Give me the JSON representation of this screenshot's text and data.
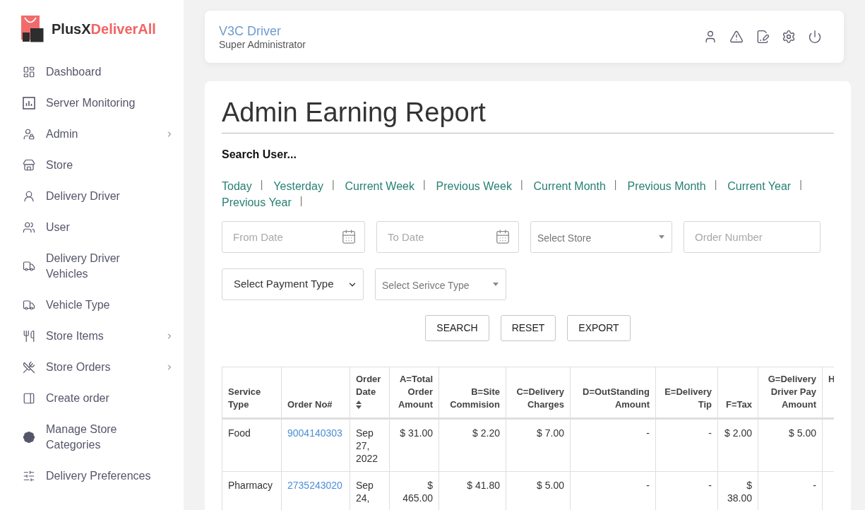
{
  "brand": {
    "name": "PlusX",
    "name_accent": "DeliverAll"
  },
  "sidebar": {
    "items": [
      {
        "label": "Dashboard",
        "has_submenu": false
      },
      {
        "label": "Server Monitoring",
        "has_submenu": false
      },
      {
        "label": "Admin",
        "has_submenu": true
      },
      {
        "label": "Store",
        "has_submenu": false
      },
      {
        "label": "Delivery Driver",
        "has_submenu": false
      },
      {
        "label": "User",
        "has_submenu": false
      },
      {
        "label": "Delivery Driver Vehicles",
        "has_submenu": false
      },
      {
        "label": "Vehicle Type",
        "has_submenu": false
      },
      {
        "label": "Store Items",
        "has_submenu": true
      },
      {
        "label": "Store Orders",
        "has_submenu": true
      },
      {
        "label": "Create order",
        "has_submenu": false
      },
      {
        "label": "Manage Store Categories",
        "has_submenu": false
      },
      {
        "label": "Delivery Preferences",
        "has_submenu": false
      }
    ]
  },
  "header": {
    "user_name": "V3C Driver",
    "role": "Super Administrator"
  },
  "report": {
    "title": "Admin Earning Report",
    "search_heading": "Search User...",
    "quick_ranges": [
      {
        "label": "Today",
        "separator": "|"
      },
      {
        "label": "Yesterday",
        "separator": "|"
      },
      {
        "label": "Current Week",
        "separator": "|"
      },
      {
        "label": "Previous Week",
        "separator": "|"
      },
      {
        "label": "Current Month",
        "separator": "|"
      },
      {
        "label": "Previous Month",
        "separator": "|"
      },
      {
        "label": "Current Year",
        "separator": "|"
      },
      {
        "label": "Previous Year",
        "separator": "|"
      }
    ],
    "filter_rows": [
      {
        "fields": [
          {
            "kind": "date",
            "placeholder": "From Date"
          },
          {
            "kind": "date",
            "placeholder": "To Date"
          },
          {
            "kind": "select",
            "placeholder": "Select Store"
          },
          {
            "kind": "text",
            "placeholder": "Order Number"
          }
        ]
      },
      {
        "fields": [
          {
            "kind": "dropdown",
            "value": "Select Payment Type"
          },
          {
            "kind": "select",
            "placeholder": "Select Serivce Type"
          }
        ]
      }
    ],
    "buttons": [
      "SEARCH",
      "RESET",
      "EXPORT"
    ],
    "table": {
      "columns": [
        {
          "label": "Service Type",
          "kind": "text",
          "sortable": false,
          "cut_off": false
        },
        {
          "label": "Order No#",
          "kind": "link",
          "sortable": false,
          "cut_off": false
        },
        {
          "label": "Order Date",
          "kind": "date",
          "sortable": true,
          "cut_off": false
        },
        {
          "label": "A=Total Order Amount",
          "kind": "amount",
          "sortable": false,
          "cut_off": false
        },
        {
          "label": "B=Site Commision",
          "kind": "amount",
          "sortable": false,
          "cut_off": false
        },
        {
          "label": "C=Delivery Charges",
          "kind": "amount",
          "sortable": false,
          "cut_off": false
        },
        {
          "label": "D=OutStanding Amount",
          "kind": "amount",
          "sortable": false,
          "cut_off": false
        },
        {
          "label": "E=Delivery Tip",
          "kind": "amount",
          "sortable": false,
          "cut_off": false
        },
        {
          "label": "F=Tax",
          "kind": "amount",
          "sortable": false,
          "cut_off": false
        },
        {
          "label": "G=Delivery Driver Pay Amount",
          "kind": "amount",
          "sortable": false,
          "cut_off": false
        },
        {
          "label": "H",
          "kind": "amount",
          "sortable": false,
          "cut_off": true
        }
      ],
      "rows": [
        {
          "cells": [
            "Food",
            "9004140303",
            "Sep 27, 2022",
            "$ 31.00",
            "$ 2.20",
            "$ 7.00",
            "-",
            "-",
            "$ 2.00",
            "$ 5.00"
          ]
        },
        {
          "cells": [
            "Pharmacy",
            "2735243020",
            "Sep 24,",
            "$ 465.00",
            "$ 41.80",
            "$ 5.00",
            "-",
            "-",
            "$ 38.00",
            "-"
          ]
        }
      ]
    }
  }
}
